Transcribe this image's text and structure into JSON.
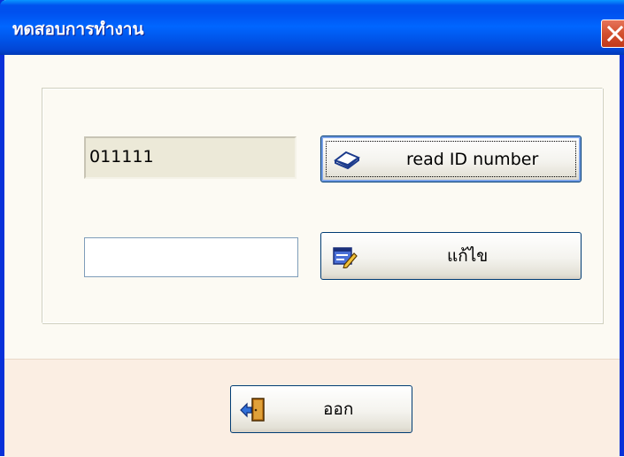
{
  "window": {
    "title": "ทดสอบการทำงาน",
    "close_icon": "close-x-icon",
    "colors": {
      "titlebar": "#0055ea",
      "close_button": "#d3502e",
      "client_background": "#fcfaf3",
      "footer_background": "#fbeee3"
    }
  },
  "form": {
    "id_field": {
      "value": "011111"
    },
    "edit_field": {
      "value": ""
    },
    "read_button": {
      "label": "read ID number",
      "icon": "book-icon"
    },
    "edit_button": {
      "label": "แก้ไข",
      "icon": "edit-pencil-icon"
    },
    "exit_button": {
      "label": "ออก",
      "icon": "exit-door-icon"
    }
  }
}
